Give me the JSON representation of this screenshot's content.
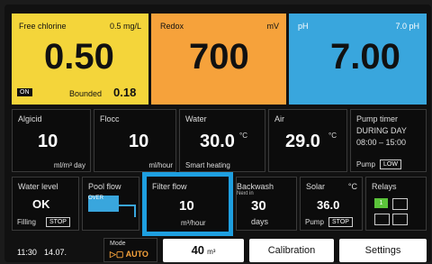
{
  "top": {
    "chlorine": {
      "label": "Free chlorine",
      "setpoint": "0.5 mg/L",
      "value": "0.50",
      "on_badge": "ON",
      "bounded_label": "Bounded",
      "bounded_value": "0.18",
      "color": "#f4d53a"
    },
    "redox": {
      "label": "Redox",
      "unit": "mV",
      "value": "700",
      "color": "#f6a23b"
    },
    "ph": {
      "label": "pH",
      "setpoint": "7.0 pH",
      "value": "7.00",
      "color": "#39a6dd"
    }
  },
  "row2": {
    "algicid": {
      "label": "Algicid",
      "value": "10",
      "unit": "ml/m³ day"
    },
    "flocc": {
      "label": "Flocc",
      "value": "10",
      "unit": "ml/hour"
    },
    "water": {
      "label": "Water",
      "value": "30.0",
      "deg": "°C",
      "sub": "Smart heating"
    },
    "air": {
      "label": "Air",
      "value": "29.0",
      "deg": "°C"
    },
    "pump_timer": {
      "label": "Pump timer",
      "line1": "DURING DAY",
      "line2": "08:00 – 15:00",
      "pump_label": "Pump",
      "pump_mode": "LOW"
    }
  },
  "row3": {
    "water_level": {
      "label": "Water level",
      "value": "OK",
      "filling": "Filling",
      "stop": "STOP"
    },
    "pool_flow": {
      "label": "Pool flow",
      "over": "OVER"
    },
    "filter_flow": {
      "label": "Filter flow",
      "value": "10",
      "unit": "m³/hour",
      "highlight": "#1e9fe0"
    },
    "backwash": {
      "label": "Backwash",
      "next": "Next in",
      "value": "30",
      "unit": "days"
    },
    "solar": {
      "label": "Solar",
      "deg": "°C",
      "value": "36.0",
      "pump": "Pump",
      "stop": "STOP"
    },
    "relays": {
      "label": "Relays",
      "relay1": "1"
    }
  },
  "bottom": {
    "time": "11:30",
    "date": "14.07.",
    "mode_label": "Mode",
    "mode_value": "▷▢ AUTO",
    "volume": "40",
    "volume_unit": "m³",
    "calibration": "Calibration",
    "settings": "Settings"
  }
}
